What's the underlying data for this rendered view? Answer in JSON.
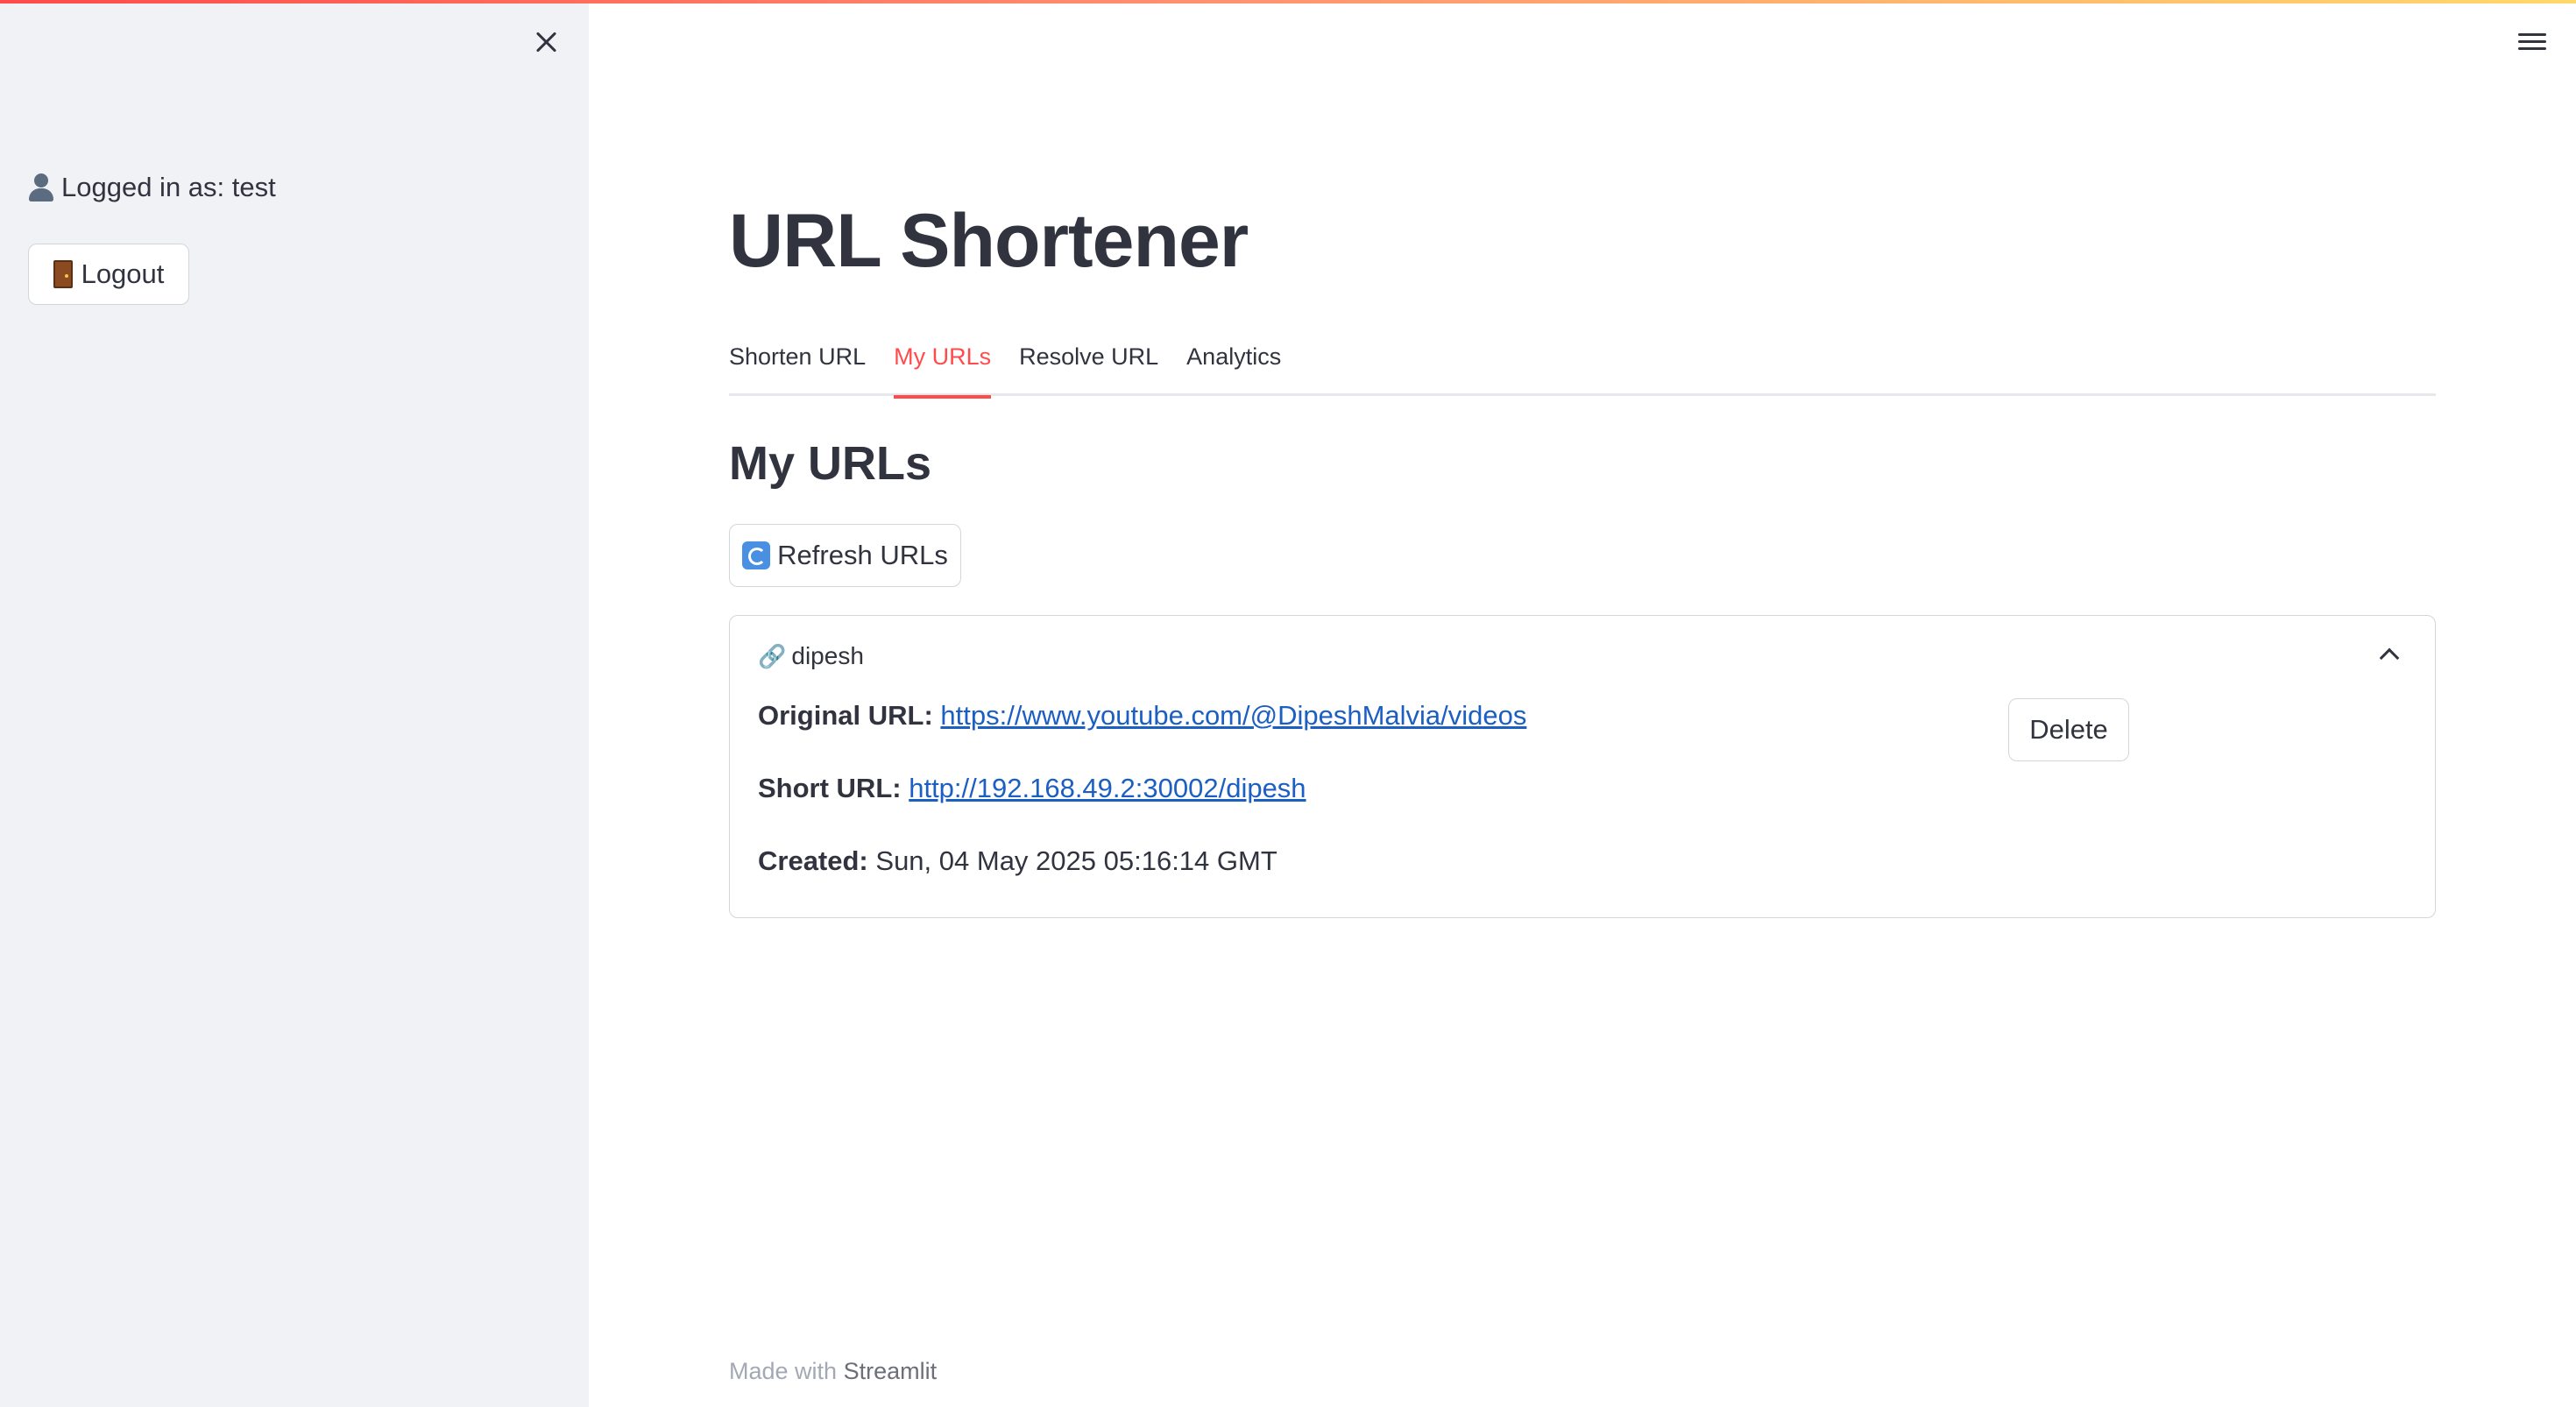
{
  "sidebar": {
    "logged_in_text": "Logged in as: test",
    "logout_label": "Logout"
  },
  "main": {
    "title": "URL Shortener",
    "tabs": [
      {
        "label": "Shorten URL"
      },
      {
        "label": "My URLs",
        "active": true
      },
      {
        "label": "Resolve URL"
      },
      {
        "label": "Analytics"
      }
    ],
    "section_title": "My URLs",
    "refresh_label": "Refresh URLs",
    "urls": [
      {
        "name": "dipesh",
        "original_label": "Original URL:",
        "original_url": "https://www.youtube.com/@DipeshMalvia/videos",
        "short_label": "Short URL:",
        "short_url": "http://192.168.49.2:30002/dipesh",
        "created_label": "Created:",
        "created": "Sun, 04 May 2025 05:16:14 GMT",
        "delete_label": "Delete"
      }
    ]
  },
  "footer": {
    "prefix": "Made with",
    "brand": "Streamlit"
  },
  "colors": {
    "accent": "#ff4b4b",
    "link": "#1c5fc2",
    "sidebar_bg": "#f0f2f6",
    "text": "#31333f"
  }
}
